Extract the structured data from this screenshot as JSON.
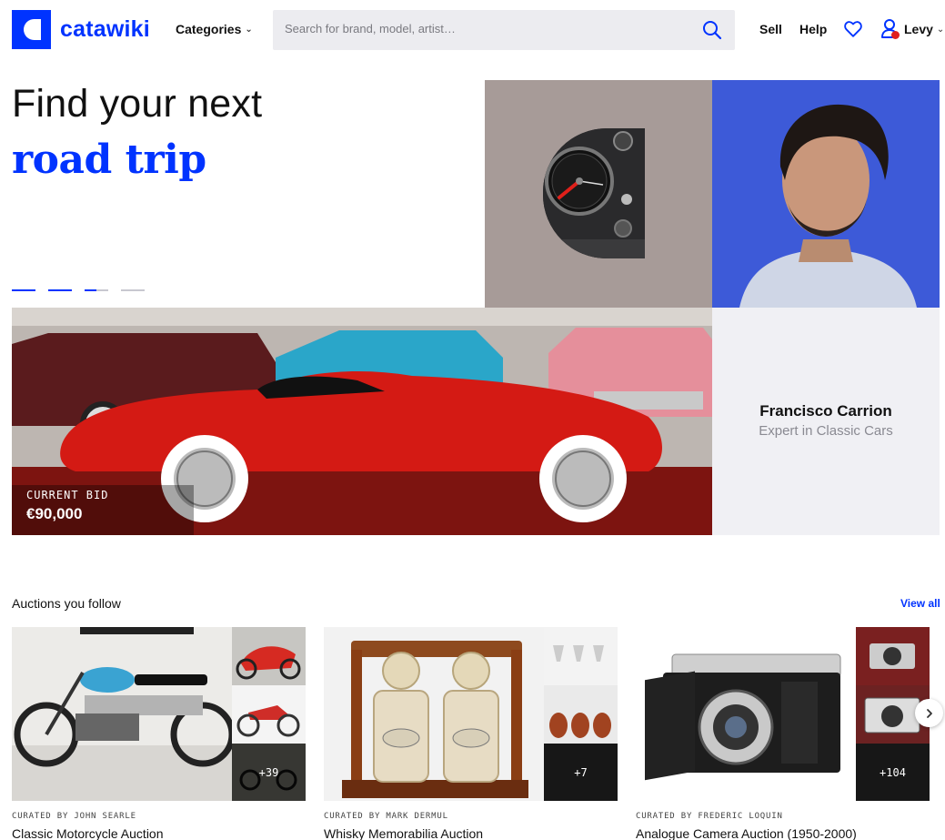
{
  "header": {
    "logo_text": "catawiki",
    "categories_label": "Categories",
    "search_placeholder": "Search for brand, model, artist…",
    "sell_label": "Sell",
    "help_label": "Help",
    "user_name": "Levy",
    "accent_color": "#0033ff"
  },
  "hero": {
    "title_line1": "Find your next",
    "title_line2": "road trip",
    "current_bid_label": "CURRENT BID",
    "current_bid_value": "€90,000",
    "expert_name": "Francisco Carrion",
    "expert_role": "Expert in Classic Cars",
    "slides": 4,
    "active_slide": 2
  },
  "auctions": {
    "section_title": "Auctions you follow",
    "view_all_label": "View all",
    "cards": [
      {
        "curator": "CURATED BY JOHN SEARLE",
        "title": "Classic Motorcycle Auction",
        "more_count": "+39"
      },
      {
        "curator": "CURATED BY MARK DERMUL",
        "title": "Whisky Memorabilia Auction",
        "more_count": "+7"
      },
      {
        "curator": "CURATED BY FREDERIC LOQUIN",
        "title": "Analogue Camera Auction (1950-2000)",
        "more_count": "+104"
      }
    ]
  }
}
